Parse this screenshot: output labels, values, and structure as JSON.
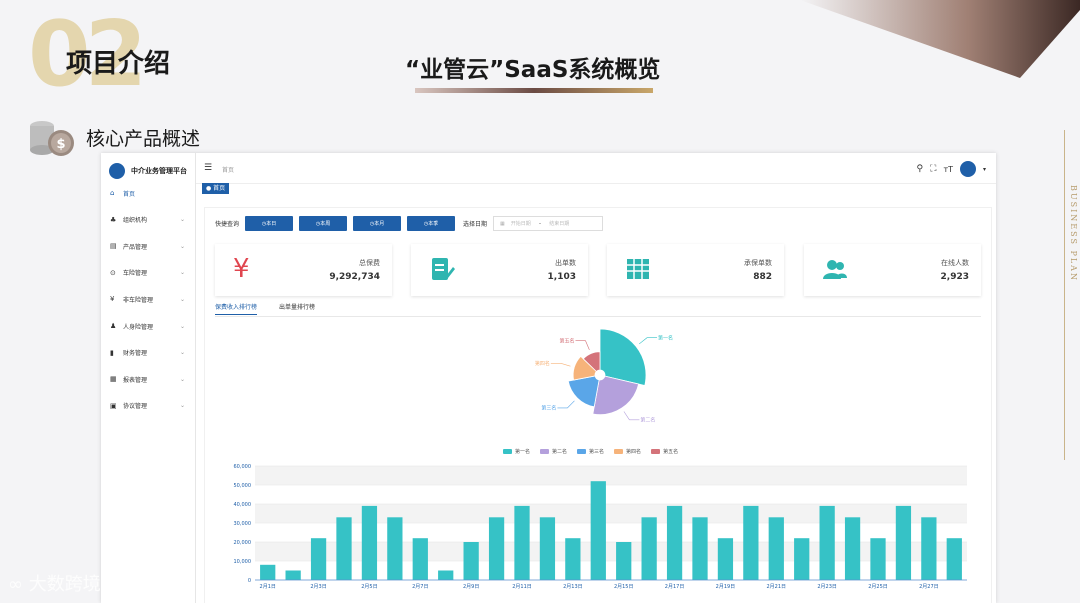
{
  "slide": {
    "section_number": "02",
    "section_title": "项目介绍",
    "main_title": "“业管云”SaaS系统概览",
    "subtitle": "核心产品概述",
    "vertical_text": "BUSINESS PLAN",
    "watermark": "大数跨境"
  },
  "app": {
    "brand": "中介业务管理平台",
    "breadcrumb": "首页",
    "home_tab": "● 首页",
    "sidebar": [
      {
        "label": "首页",
        "icon": "home-icon",
        "has_arrow": false
      },
      {
        "label": "组织机构",
        "icon": "org-icon",
        "has_arrow": true
      },
      {
        "label": "产品管理",
        "icon": "product-icon",
        "has_arrow": true
      },
      {
        "label": "车险管理",
        "icon": "car-icon",
        "has_arrow": true
      },
      {
        "label": "非车险管理",
        "icon": "yen-icon",
        "has_arrow": true
      },
      {
        "label": "人身险管理",
        "icon": "person-icon",
        "has_arrow": true
      },
      {
        "label": "财务管理",
        "icon": "finance-icon",
        "has_arrow": true
      },
      {
        "label": "报表管理",
        "icon": "report-icon",
        "has_arrow": true
      },
      {
        "label": "协议管理",
        "icon": "agreement-icon",
        "has_arrow": true
      }
    ],
    "quick_query": {
      "label": "快捷查询",
      "buttons": [
        "本日",
        "本周",
        "本月",
        "本季"
      ],
      "date_label": "选择日期",
      "start_placeholder": "开始日期",
      "separator": "–",
      "end_placeholder": "结束日期"
    },
    "stats": [
      {
        "label": "总保费",
        "value": "9,292,734",
        "icon": "yen-icon",
        "color": "#e0454f"
      },
      {
        "label": "出单数",
        "value": "1,103",
        "icon": "document-edit-icon",
        "color": "#2fb5b0"
      },
      {
        "label": "承保单数",
        "value": "882",
        "icon": "table-icon",
        "color": "#2fb5b0"
      },
      {
        "label": "在线人数",
        "value": "2,923",
        "icon": "users-icon",
        "color": "#2fb5b0"
      }
    ],
    "subtabs": [
      "保费收入排行榜",
      "出单量排行榜"
    ]
  },
  "colors": {
    "accent": "#1f5fa8",
    "teal": "#36c2c6",
    "purple": "#b4a0dc",
    "blue": "#5aa6e8",
    "orange": "#f6b37a",
    "red": "#d4737a"
  },
  "chart_data": [
    {
      "type": "pie",
      "variant": "rose",
      "categories": [
        "第一名",
        "第二名",
        "第三名",
        "第四名",
        "第五名"
      ],
      "values": [
        45,
        38,
        30,
        24,
        20
      ],
      "legend_position": "bottom"
    },
    {
      "type": "bar",
      "categories": [
        "2月1日",
        "2月2日",
        "2月3日",
        "2月4日",
        "2月5日",
        "2月6日",
        "2月7日",
        "2月8日",
        "2月9日",
        "2月10日",
        "2月11日",
        "2月12日",
        "2月13日",
        "2月14日",
        "2月15日",
        "2月16日",
        "2月17日",
        "2月18日",
        "2月19日",
        "2月20日",
        "2月21日",
        "2月22日",
        "2月23日",
        "2月24日",
        "2月25日",
        "2月26日",
        "2月27日",
        "2月28日"
      ],
      "tick_labels": [
        "2月1日",
        "2月3日",
        "2月5日",
        "2月7日",
        "2月9日",
        "2月11日",
        "2月13日",
        "2月15日",
        "2月17日",
        "2月19日",
        "2月21日",
        "2月23日",
        "2月25日",
        "2月27日"
      ],
      "values": [
        8000,
        5000,
        22000,
        33000,
        39000,
        33000,
        22000,
        5000,
        20000,
        33000,
        39000,
        33000,
        22000,
        52000,
        20000,
        33000,
        39000,
        33000,
        22000,
        39000,
        33000,
        22000,
        39000,
        33000,
        22000,
        39000,
        33000,
        22000
      ],
      "y_ticks": [
        "0",
        "10,000",
        "20,000",
        "30,000",
        "40,000",
        "50,000",
        "60,000"
      ],
      "ylim": [
        0,
        60000
      ],
      "grid": true
    }
  ]
}
